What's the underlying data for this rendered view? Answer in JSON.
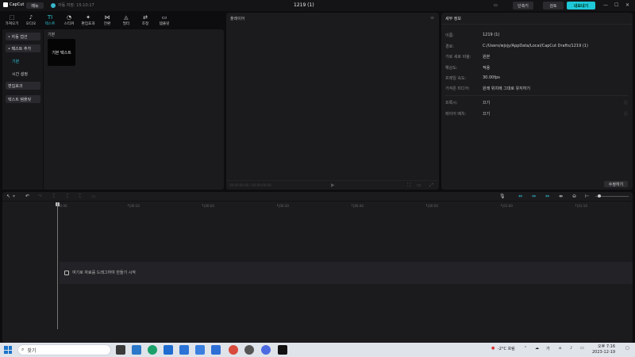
{
  "topbar": {
    "logo": "CapCut",
    "menu": "메뉴",
    "autosave": "자동 저장: 15:10:17",
    "project_title": "1219 (1)",
    "shortcut": "단축키",
    "review": "검토",
    "export": "내보내기",
    "window_controls": [
      "—",
      "☐",
      "✕"
    ]
  },
  "tools": [
    {
      "label": "가져오기",
      "icon": "import-icon",
      "glyph": "⬚"
    },
    {
      "label": "오디오",
      "icon": "audio-icon",
      "glyph": "♪"
    },
    {
      "label": "텍스트",
      "icon": "text-icon",
      "glyph": "TI",
      "active": true
    },
    {
      "label": "스티커",
      "icon": "sticker-icon",
      "glyph": "◔"
    },
    {
      "label": "편집효과",
      "icon": "effects-icon",
      "glyph": "✦"
    },
    {
      "label": "전환",
      "icon": "transition-icon",
      "glyph": "⋈"
    },
    {
      "label": "필터",
      "icon": "filter-icon",
      "glyph": "◬"
    },
    {
      "label": "조정",
      "icon": "adjust-icon",
      "glyph": "⇄"
    },
    {
      "label": "템플릿",
      "icon": "template-icon",
      "glyph": "▭"
    }
  ],
  "left_nav": {
    "auto_caption": "• 자동 캡션",
    "add_text": "• 텍스트 추가",
    "basic": "기본",
    "timer": "시간 설정",
    "effects": "편집효과",
    "text_template": "텍스트 템플릿"
  },
  "text_panel": {
    "section": "기본",
    "card": "기본 텍스트"
  },
  "player": {
    "title": "플레이어",
    "time": "00:00:00:00 / 00:00:00:00",
    "play": "▶"
  },
  "details": {
    "title": "세부 정보",
    "rows": [
      {
        "k": "이름:",
        "v": "1219 (1)"
      },
      {
        "k": "경로:",
        "v": "C:/Users/wjsjy/AppData/Local/CapCut Drafts/1219 (1)"
      },
      {
        "k": "가로 세로 비율:",
        "v": "원본"
      },
      {
        "k": "해상도:",
        "v": "적용"
      },
      {
        "k": "프레임 속도:",
        "v": "30.00fps"
      },
      {
        "k": "가져온 미디어:",
        "v": "원래 위치에 그대로 유지하기"
      }
    ],
    "rows2": [
      {
        "k": "프록시:",
        "v": "끄기"
      },
      {
        "k": "레이어 배치:",
        "v": "끄기"
      }
    ],
    "modify": "수정하기"
  },
  "timeline": {
    "ticks": [
      "00:00",
      "|00:10",
      "|00:20",
      "|00:30",
      "|00:40",
      "|00:50",
      "|01:00",
      "|01:10"
    ],
    "hint": "여기로 자료를 드래그하여 만들기 시작"
  },
  "taskbar": {
    "search": "찾기",
    "weather": "-2°C 흐림",
    "time": "오후 7:16",
    "date": "2023-12-19",
    "app_colors": [
      "#9e3b3b",
      "#3a3a3a",
      "#1f7bd4",
      "#1aa16a",
      "#1f6bd0",
      "#2b73d6",
      "#d84a3b",
      "#2e6fd6",
      "#4d6be0",
      "#111"
    ]
  }
}
